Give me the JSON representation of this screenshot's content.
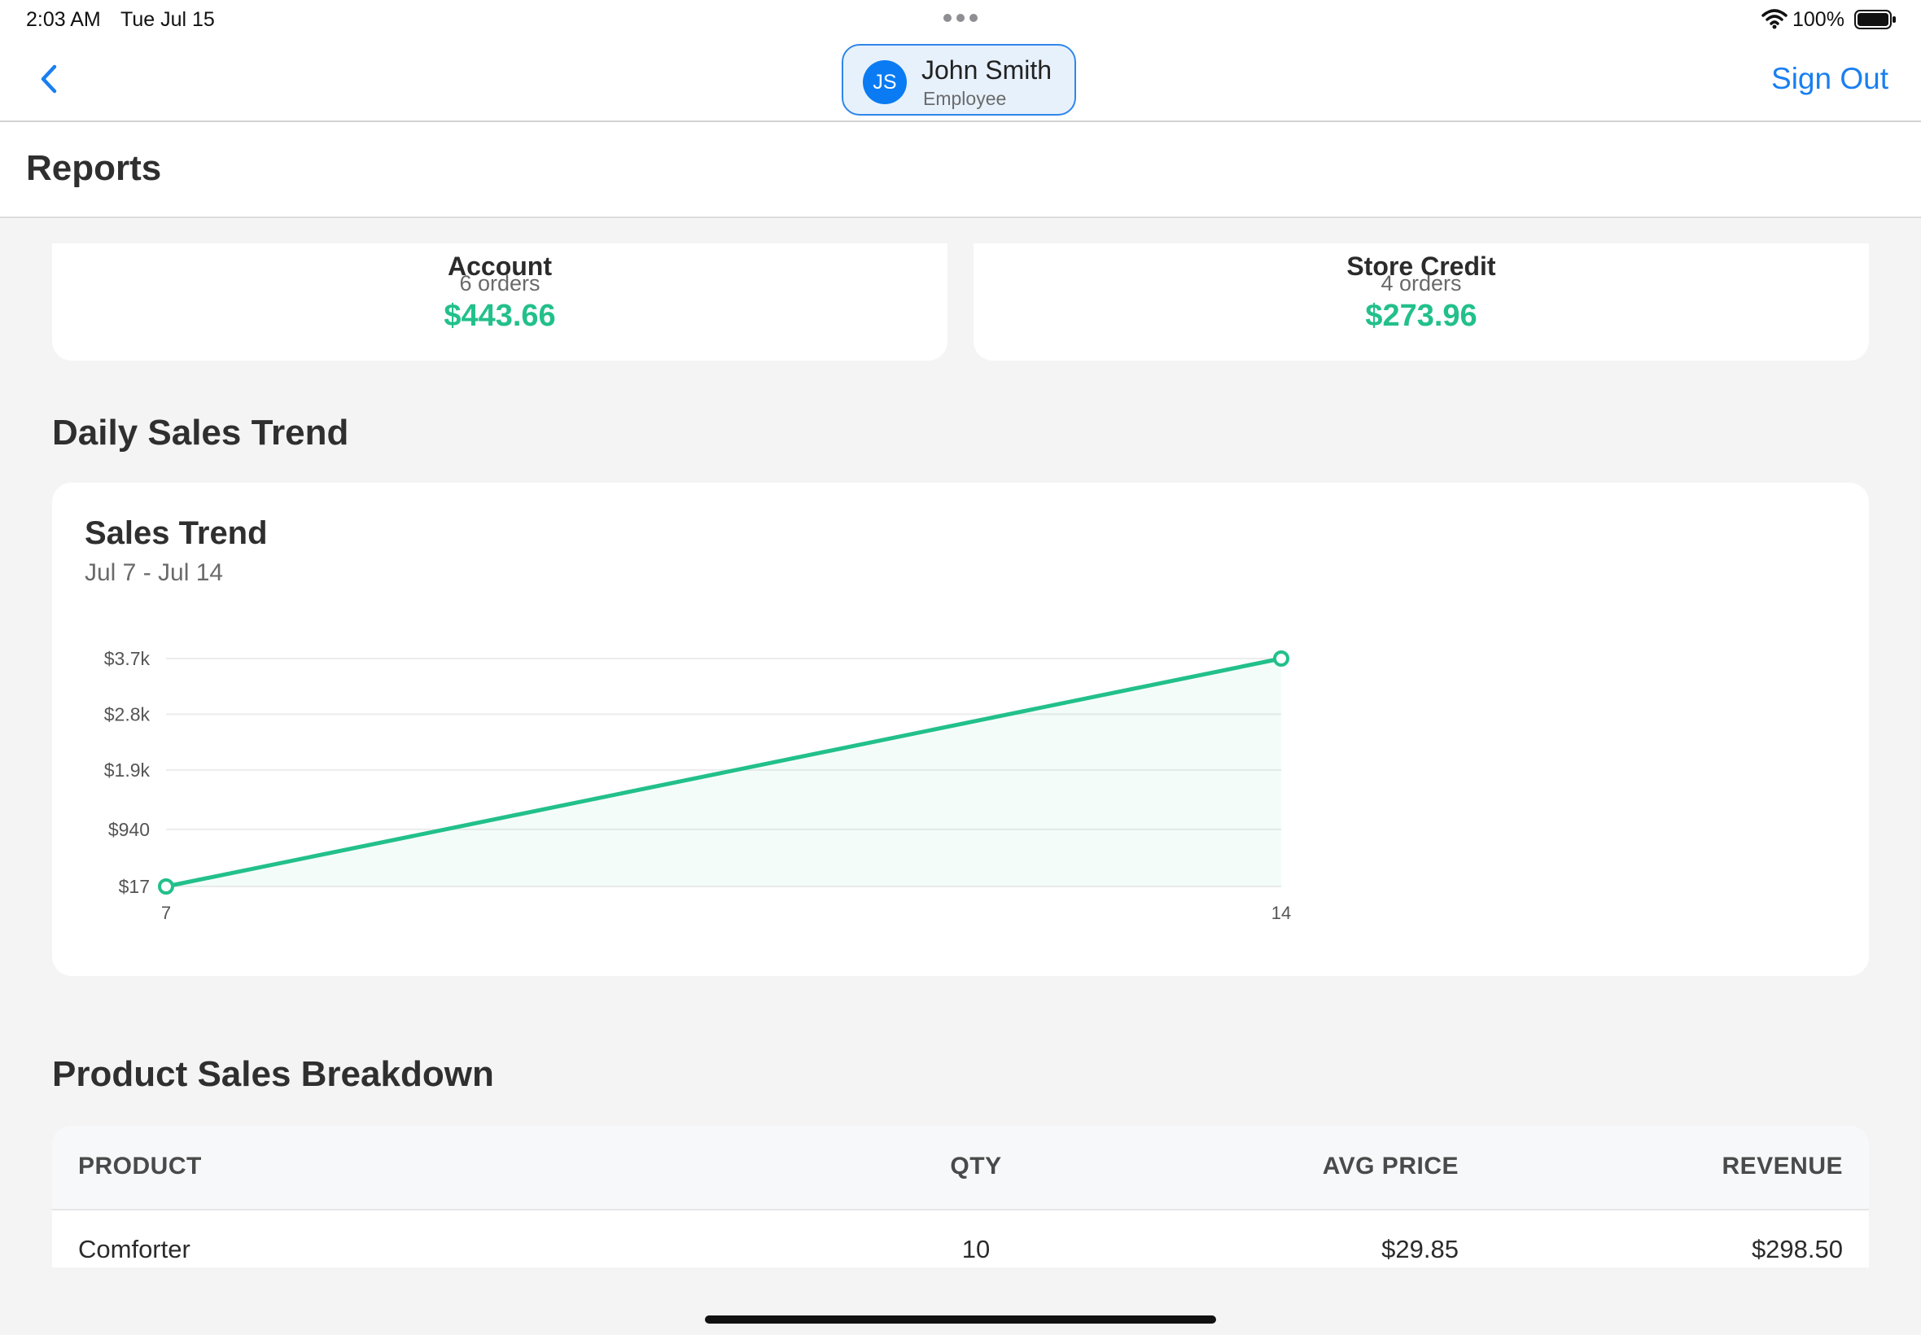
{
  "status_bar": {
    "time": "2:03 AM",
    "date": "Tue Jul 15",
    "battery": "100%"
  },
  "nav": {
    "user": {
      "initials": "JS",
      "name": "John Smith",
      "role": "Employee"
    },
    "sign_out_label": "Sign Out"
  },
  "header": {
    "title": "Reports"
  },
  "payment_methods": [
    {
      "name": "Account",
      "orders": "6 orders",
      "amount": "$443.66"
    },
    {
      "name": "Store Credit",
      "orders": "4 orders",
      "amount": "$273.96"
    }
  ],
  "daily_sales": {
    "section_title": "Daily Sales Trend"
  },
  "chart_data": {
    "type": "area",
    "title": "Sales Trend",
    "subtitle": "Jul 7 - Jul 14",
    "x": [
      7,
      14
    ],
    "x_tick_labels": [
      "7",
      "14"
    ],
    "series": [
      {
        "values": [
          17,
          3700
        ]
      }
    ],
    "y_ticks": [
      17,
      940,
      1900,
      2800,
      3700
    ],
    "y_tick_labels": [
      "$17",
      "$940",
      "$1.9k",
      "$2.8k",
      "$3.7k"
    ],
    "ylim": [
      17,
      3700
    ],
    "grid": true,
    "colors": {
      "line": "#22c08a"
    }
  },
  "product_sales": {
    "section_title": "Product Sales Breakdown",
    "columns": [
      "PRODUCT",
      "QTY",
      "AVG PRICE",
      "REVENUE"
    ],
    "rows": [
      {
        "product": "Comforter",
        "qty": "10",
        "avg_price": "$29.85",
        "revenue": "$298.50"
      }
    ]
  }
}
